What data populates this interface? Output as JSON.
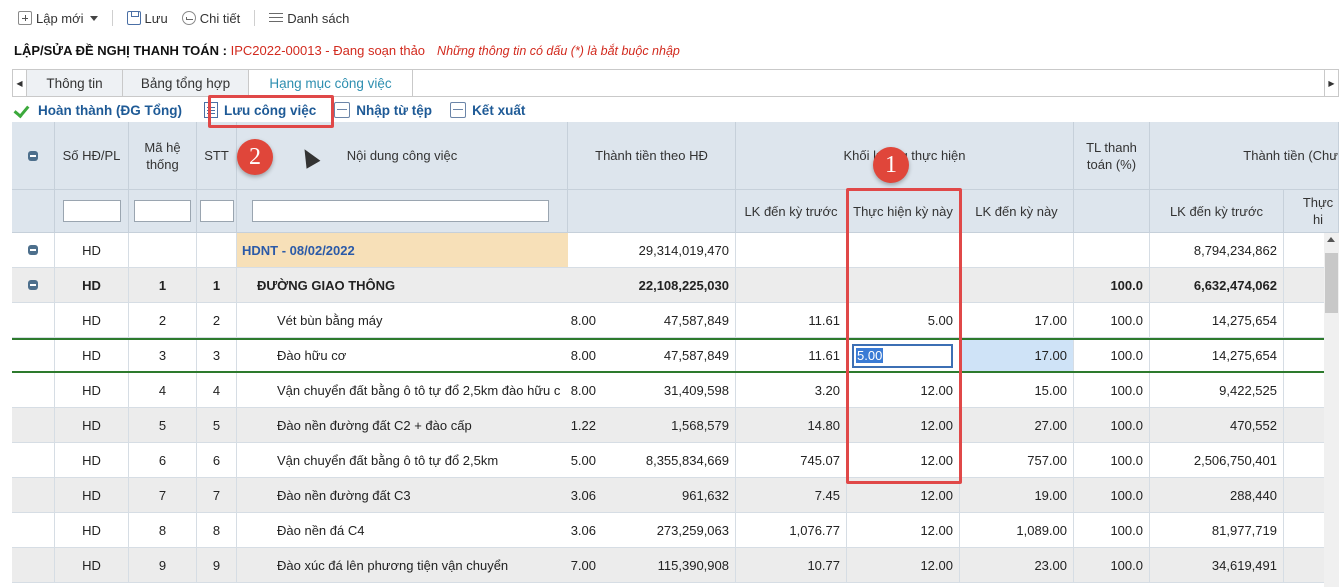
{
  "toolbar": {
    "new_label": "Lập mới",
    "save_label": "Lưu",
    "detail_label": "Chi tiết",
    "list_label": "Danh sách"
  },
  "title": {
    "main": "LẬP/SỬA ĐỀ NGHỊ THANH TOÁN : ",
    "code_status": "IPC2022-00013 - Đang soạn thảo",
    "note": "Những thông tin có dấu (*) là bắt buộc nhập"
  },
  "tabs": [
    "Thông tin",
    "Bảng tổng hợp",
    "Hạng mục công việc"
  ],
  "actions": {
    "complete": "Hoàn thành (ĐG Tổng)",
    "save_work": "Lưu công việc",
    "import": "Nhập từ tệp",
    "export": "Kết xuất"
  },
  "columns": {
    "contract": "Số HĐ/PL",
    "system_code": "Mã hệ thống",
    "stt": "STT",
    "content": "Nội dung công việc",
    "amount_contract": "Thành tiền theo HĐ",
    "volume_group": "Khối lượng thực hiện",
    "prev_accum": "LK đến kỳ trước",
    "this_period": "Thực hiện kỳ này",
    "accum_now": "LK đến kỳ này",
    "pay_ratio": "TL thanh toán (%)",
    "amount_group": "Thành tiền (Chư",
    "amount_prev_accum": "LK đến kỳ trước",
    "amount_this_period": "Thực hi"
  },
  "rows": [
    {
      "contract": "HD",
      "code": "",
      "stt": "",
      "content": "HDNT - 08/02/2022",
      "qty": "",
      "amount": "29,314,019,470",
      "prev": "",
      "now": "",
      "accum": "",
      "ratio": "",
      "amt_prev": "8,794,234,862"
    },
    {
      "contract": "HD",
      "code": "1",
      "stt": "1",
      "content": "ĐƯỜNG GIAO THÔNG",
      "qty": "",
      "amount": "22,108,225,030",
      "prev": "",
      "now": "",
      "accum": "",
      "ratio": "100.0",
      "amt_prev": "6,632,474,062"
    },
    {
      "contract": "HD",
      "code": "2",
      "stt": "2",
      "content": "Vét bùn bằng máy",
      "qty": "8.00",
      "amount": "47,587,849",
      "prev": "11.61",
      "now": "5.00",
      "accum": "17.00",
      "ratio": "100.0",
      "amt_prev": "14,275,654"
    },
    {
      "contract": "HD",
      "code": "3",
      "stt": "3",
      "content": "Đào hữu cơ",
      "qty": "8.00",
      "amount": "47,587,849",
      "prev": "11.61",
      "now": "5.00",
      "accum": "17.00",
      "ratio": "100.0",
      "amt_prev": "14,275,654"
    },
    {
      "contract": "HD",
      "code": "4",
      "stt": "4",
      "content": "Vận chuyển đất bằng ô tô tự đổ 2,5km đào hữu c",
      "qty": "8.00",
      "amount": "31,409,598",
      "prev": "3.20",
      "now": "12.00",
      "accum": "15.00",
      "ratio": "100.0",
      "amt_prev": "9,422,525"
    },
    {
      "contract": "HD",
      "code": "5",
      "stt": "5",
      "content": "Đào nền đường đất C2 + đào cấp",
      "qty": "1.22",
      "amount": "1,568,579",
      "prev": "14.80",
      "now": "12.00",
      "accum": "27.00",
      "ratio": "100.0",
      "amt_prev": "470,552"
    },
    {
      "contract": "HD",
      "code": "6",
      "stt": "6",
      "content": "Vận chuyển đất bằng ô tô tự đổ 2,5km",
      "qty": "5.00",
      "amount": "8,355,834,669",
      "prev": "745.07",
      "now": "12.00",
      "accum": "757.00",
      "ratio": "100.0",
      "amt_prev": "2,506,750,401"
    },
    {
      "contract": "HD",
      "code": "7",
      "stt": "7",
      "content": "Đào nền đường đất C3",
      "qty": "3.06",
      "amount": "961,632",
      "prev": "7.45",
      "now": "12.00",
      "accum": "19.00",
      "ratio": "100.0",
      "amt_prev": "288,440"
    },
    {
      "contract": "HD",
      "code": "8",
      "stt": "8",
      "content": "Đào nền đá C4",
      "qty": "3.06",
      "amount": "273,259,063",
      "prev": "1,076.77",
      "now": "12.00",
      "accum": "1,089.00",
      "ratio": "100.0",
      "amt_prev": "81,977,719"
    },
    {
      "contract": "HD",
      "code": "9",
      "stt": "9",
      "content": "Đào xúc đá lên phương tiện vận chuyển",
      "qty": "7.00",
      "amount": "115,390,908",
      "prev": "10.77",
      "now": "12.00",
      "accum": "23.00",
      "ratio": "100.0",
      "amt_prev": "34,619,491"
    }
  ],
  "annotations": {
    "badge1": "1",
    "badge2": "2"
  },
  "colors": {
    "header_bg": "#dde5ed",
    "group_bg": "#f7e0b8",
    "accent": "#d22a1e",
    "selected_border": "#2d7a2d"
  }
}
